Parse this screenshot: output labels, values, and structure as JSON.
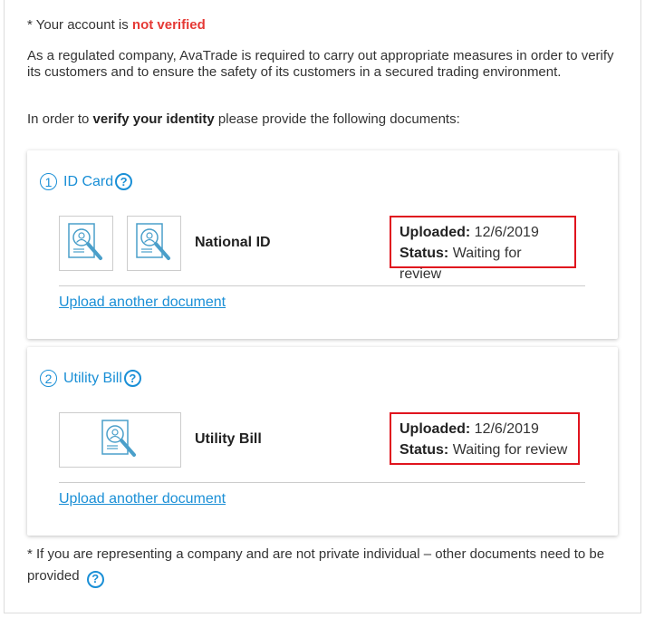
{
  "notice": {
    "prefix": "* Your account is ",
    "status": "not verified",
    "status_color": "#e53935"
  },
  "intro_text": "As a regulated company, AvaTrade is required to carry out appropriate measures in order to verify its customers and to ensure the safety of its customers in a secured trading environment.",
  "request": {
    "prefix": "In order to ",
    "emphasis": "verify your identity",
    "suffix": " please provide the following documents:"
  },
  "sections": [
    {
      "number": "1",
      "title": "ID Card",
      "help_icon": "question-circle-icon",
      "doc_icon": "id-search-icon",
      "doc_name": "National ID",
      "uploaded_label": "Uploaded:",
      "uploaded_value": "12/6/2019",
      "status_label": "Status:",
      "status_value": "Waiting for review",
      "upload_link": "Upload another document"
    },
    {
      "number": "2",
      "title": "Utility Bill",
      "help_icon": "question-circle-icon",
      "doc_icon": "id-search-icon",
      "doc_name": "Utility Bill",
      "uploaded_label": "Uploaded:",
      "uploaded_value": "12/6/2019",
      "status_label": "Status:",
      "status_value": "Waiting for review",
      "upload_link": "Upload another document"
    }
  ],
  "footer_note": "* If you are representing a company and are not private individual – other documents need to be provided",
  "help_glyph": "?",
  "colors": {
    "accent": "#1a8fd6",
    "highlight_border": "#e0141e"
  }
}
